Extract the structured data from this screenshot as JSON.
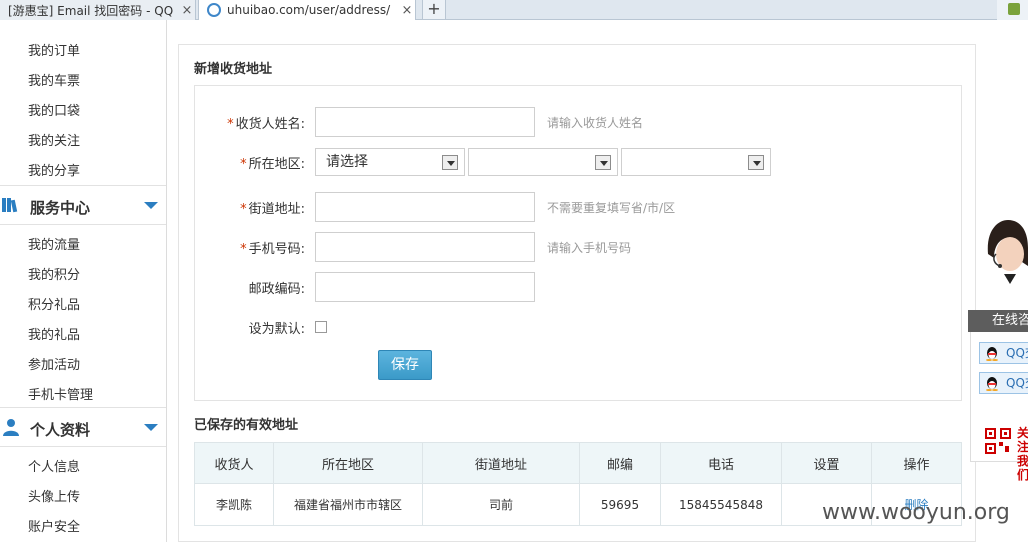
{
  "browser": {
    "tab1_title": "[游惠宝] Email 找回密码 - QQ",
    "tab2_title": "uhuibao.com/user/address/",
    "close_glyph": "×",
    "new_tab_glyph": "+"
  },
  "sidebar": {
    "group1_items": [
      "我的订单",
      "我的车票",
      "我的口袋",
      "我的关注",
      "我的分享"
    ],
    "group2_title": "服务中心",
    "group2_items": [
      "我的流量",
      "我的积分",
      "积分礼品",
      "我的礼品",
      "参加活动",
      "手机卡管理"
    ],
    "group3_title": "个人资料",
    "group3_items": [
      "个人信息",
      "头像上传",
      "账户安全"
    ]
  },
  "form": {
    "title": "新增收货地址",
    "required_mark": "*",
    "name_label": "收货人姓名:",
    "name_hint": "请输入收货人姓名",
    "region_label": "所在地区:",
    "region_select1": "请选择",
    "street_label": "街道地址:",
    "street_hint": "不需要重复填写省/市/区",
    "phone_label": "手机号码:",
    "phone_hint": "请输入手机号码",
    "zip_label": "邮政编码:",
    "default_label": "设为默认:",
    "save_label": "保存"
  },
  "saved": {
    "title": "已保存的有效地址",
    "headers": [
      "收货人",
      "所在地区",
      "街道地址",
      "邮编",
      "电话",
      "设置",
      "操作"
    ],
    "rows": [
      {
        "name": "李凯陈",
        "region": "福建省福州市市辖区",
        "street": "司前",
        "zip": "59695",
        "phone": "15845545848",
        "setting": "",
        "op": "删除"
      }
    ]
  },
  "service": {
    "bar_label": "在线咨询",
    "qq1": "QQ交谈",
    "qq2": "QQ交谈",
    "qr_text": "关注我们"
  },
  "watermark": "www.wooyun.org",
  "colors": {
    "accent": "#2b7ec1",
    "save_button": "#3b9ac8",
    "required": "#cc3300"
  }
}
